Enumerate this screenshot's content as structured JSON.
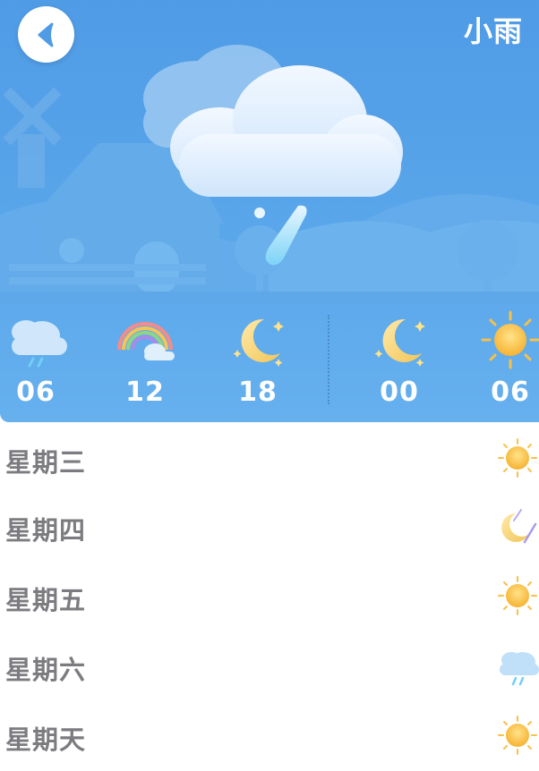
{
  "header": {
    "condition": "小雨",
    "back_icon": "chevron-left-icon"
  },
  "main_icon": "cloud-rain-icon",
  "colors": {
    "sky": "#5aa6ea",
    "sky_dark": "#4f9be6",
    "scenery": "#6ab0ea",
    "sun": "#f7b733",
    "text_white": "#ffffff",
    "day_text": "#7c7c80"
  },
  "hourly": [
    {
      "time": "06",
      "icon": "cloud-rain-icon"
    },
    {
      "time": "12",
      "icon": "rainbow-icon"
    },
    {
      "time": "18",
      "icon": "moon-icon"
    },
    {
      "time": "00",
      "icon": "moon-icon"
    },
    {
      "time": "06",
      "icon": "sun-icon"
    }
  ],
  "forecast": [
    {
      "day": "星期三",
      "icon": "sun-icon"
    },
    {
      "day": "星期四",
      "icon": "moon-meteor-icon"
    },
    {
      "day": "星期五",
      "icon": "sun-icon"
    },
    {
      "day": "星期六",
      "icon": "cloud-rain-icon"
    },
    {
      "day": "星期天",
      "icon": "sun-icon"
    }
  ]
}
